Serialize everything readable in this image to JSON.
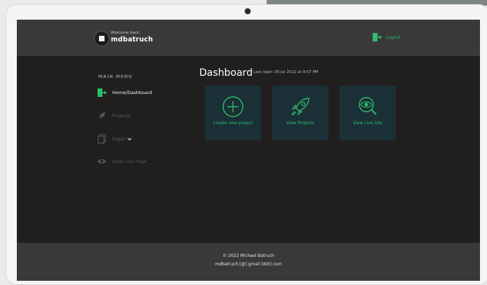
{
  "header": {
    "welcome_text": "Welcome back,",
    "username": "mdbatruch",
    "logout_label": "Logout"
  },
  "sidebar": {
    "heading": "MAIN MENU",
    "items": [
      {
        "label": "Home/Dashboard",
        "icon": "logout-door-icon",
        "active": true
      },
      {
        "label": "Projects",
        "icon": "rocket-icon",
        "active": false
      },
      {
        "label": "Pages",
        "icon": "pages-icon",
        "active": false
      },
      {
        "label": "View Live Page",
        "icon": "eye-icon",
        "active": false
      }
    ]
  },
  "main": {
    "title": "Dashboard",
    "last_login": "Last login: 05 Jul 2022 at 9:57 PM",
    "cards": [
      {
        "label": "Create new project",
        "icon": "plus-circle-icon"
      },
      {
        "label": "View Projects",
        "icon": "rocket-icon"
      },
      {
        "label": "View Live Site",
        "icon": "eye-search-icon"
      }
    ]
  },
  "footer": {
    "line1": "© 2022 Michael Batruch",
    "line2": "mdbatruch [@] gmail [dot] com"
  },
  "colors": {
    "accent": "#2ebd6b",
    "card_bg": "#1a3036",
    "topbar_bg": "#393939",
    "screen_bg": "#211f1e"
  }
}
